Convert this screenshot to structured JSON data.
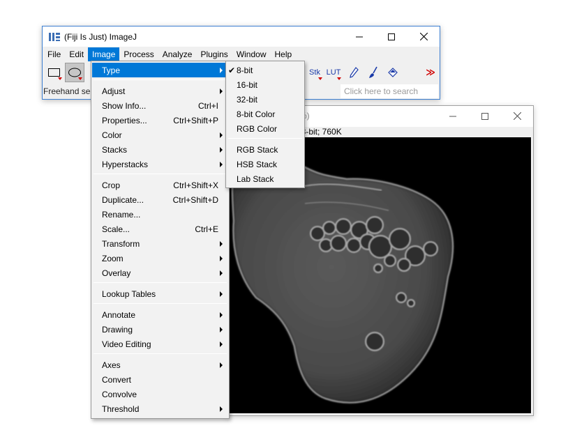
{
  "main_window": {
    "title": "(Fiji Is Just) ImageJ",
    "menus": [
      "File",
      "Edit",
      "Image",
      "Process",
      "Analyze",
      "Plugins",
      "Window",
      "Help"
    ],
    "toolbar": {
      "stk_label": "Stk",
      "lut_label": "LUT",
      "more_label": "≫"
    },
    "status_text": "Freehand se",
    "search_placeholder": "Click here to search"
  },
  "image_window": {
    "title_fragment": "%)",
    "info": "; 8-bit; 760K"
  },
  "image_menu": {
    "items": [
      {
        "label": "Type",
        "shortcut": "",
        "submenu": true
      },
      {
        "label": "Adjust",
        "shortcut": "",
        "submenu": true
      },
      {
        "label": "Show Info...",
        "shortcut": "Ctrl+I",
        "submenu": false
      },
      {
        "label": "Properties...",
        "shortcut": "Ctrl+Shift+P",
        "submenu": false
      },
      {
        "label": "Color",
        "shortcut": "",
        "submenu": true
      },
      {
        "label": "Stacks",
        "shortcut": "",
        "submenu": true
      },
      {
        "label": "Hyperstacks",
        "shortcut": "",
        "submenu": true
      },
      {
        "label": "Crop",
        "shortcut": "Ctrl+Shift+X",
        "submenu": false
      },
      {
        "label": "Duplicate...",
        "shortcut": "Ctrl+Shift+D",
        "submenu": false
      },
      {
        "label": "Rename...",
        "shortcut": "",
        "submenu": false
      },
      {
        "label": "Scale...",
        "shortcut": "Ctrl+E",
        "submenu": false
      },
      {
        "label": "Transform",
        "shortcut": "",
        "submenu": true
      },
      {
        "label": "Zoom",
        "shortcut": "",
        "submenu": true
      },
      {
        "label": "Overlay",
        "shortcut": "",
        "submenu": true
      },
      {
        "label": "Lookup Tables",
        "shortcut": "",
        "submenu": true
      },
      {
        "label": "Annotate",
        "shortcut": "",
        "submenu": true
      },
      {
        "label": "Drawing",
        "shortcut": "",
        "submenu": true
      },
      {
        "label": "Video Editing",
        "shortcut": "",
        "submenu": true
      },
      {
        "label": "Axes",
        "shortcut": "",
        "submenu": true
      },
      {
        "label": "Convert",
        "shortcut": "",
        "submenu": false
      },
      {
        "label": "Convolve",
        "shortcut": "",
        "submenu": false
      },
      {
        "label": "Threshold",
        "shortcut": "",
        "submenu": true
      }
    ]
  },
  "type_menu": {
    "items": [
      {
        "label": "8-bit",
        "checked": true
      },
      {
        "label": "16-bit",
        "checked": false
      },
      {
        "label": "32-bit",
        "checked": false
      },
      {
        "label": "8-bit Color",
        "checked": false
      },
      {
        "label": "RGB Color",
        "checked": false
      },
      {
        "label": "RGB Stack",
        "checked": false
      },
      {
        "label": "HSB Stack",
        "checked": false
      },
      {
        "label": "Lab Stack",
        "checked": false
      }
    ],
    "check_mark": "✔"
  },
  "colors": {
    "highlight": "#0078d7",
    "window_border": "#3c7fd1",
    "tool_arrow": "#d00000"
  }
}
